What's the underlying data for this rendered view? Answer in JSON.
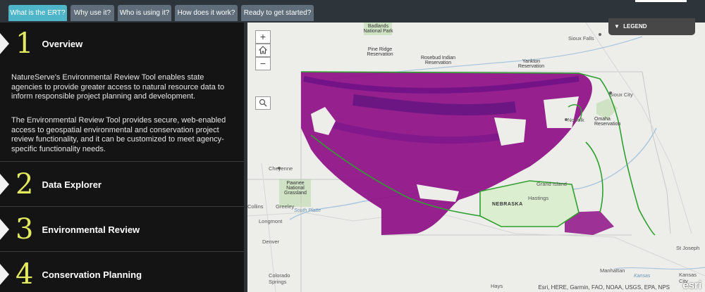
{
  "tabs": [
    {
      "label": "What is the ERT?",
      "active": true
    },
    {
      "label": "Why use it?"
    },
    {
      "label": "Who is using it?"
    },
    {
      "label": "How does it work?"
    },
    {
      "label": "Ready to get started?"
    }
  ],
  "sections": [
    {
      "number": "1",
      "title": "Overview"
    },
    {
      "number": "2",
      "title": "Data Explorer"
    },
    {
      "number": "3",
      "title": "Environmental Review"
    },
    {
      "number": "4",
      "title": "Conservation Planning"
    }
  ],
  "overview": {
    "p1": "NatureServe's Environmental Review Tool enables state agencies to provide greater access to natural resource data to inform responsible project planning and development.",
    "p2": "The Environmental Review Tool provides secure, web-enabled access to geospatial environmental and conservation project review functionality, and it can be customized to meet agency-specific functionality needs."
  },
  "map": {
    "zoom_in": "+",
    "home_icon": "home-icon",
    "zoom_out": "−",
    "search_icon": "search-icon",
    "legend_label": "LEGEND",
    "legend_icon": "chevron-down-icon",
    "attribution": "Esri, HERE, Garmin, FAO, NOAA, USGS, EPA, NPS",
    "esri_logo": "esri",
    "labels": [
      {
        "text": "Badlands National Park",
        "cls": "park"
      },
      {
        "text": "Pine Ridge Reservation",
        "cls": "park"
      },
      {
        "text": "Rosebud Indian Reservation",
        "cls": "park"
      },
      {
        "text": "Yankton Reservation",
        "cls": "park"
      },
      {
        "text": "Sioux Falls",
        "cls": "city"
      },
      {
        "text": "Sioux City",
        "cls": "city"
      },
      {
        "text": "Norfolk",
        "cls": "city"
      },
      {
        "text": "Omaha Reservation",
        "cls": "park"
      },
      {
        "text": "Cheyenne",
        "cls": "city"
      },
      {
        "text": "Pawnee National Grassland",
        "cls": "park"
      },
      {
        "text": "Collins",
        "cls": "city"
      },
      {
        "text": "Greeley",
        "cls": "city"
      },
      {
        "text": "Longmont",
        "cls": "city"
      },
      {
        "text": "Denver",
        "cls": "city"
      },
      {
        "text": "Grand Island",
        "cls": "city"
      },
      {
        "text": "NEBRASKA",
        "cls": "state"
      },
      {
        "text": "Hastings",
        "cls": "city"
      },
      {
        "text": "St Joseph",
        "cls": "city"
      },
      {
        "text": "Manhattan",
        "cls": "city"
      },
      {
        "text": "Colorado Springs",
        "cls": "city"
      },
      {
        "text": "Hays",
        "cls": "city"
      },
      {
        "text": "Kansas City",
        "cls": "city"
      },
      {
        "text": "South Platte",
        "cls": "river"
      },
      {
        "text": "Kansas",
        "cls": "river"
      }
    ]
  },
  "colors": {
    "tab_active": "#4fb5c9",
    "tab": "#5f6e7a",
    "number": "#e3ea60",
    "sidebar": "#141414",
    "habitat": "#8e0f86",
    "outline": "#2fa02f"
  }
}
